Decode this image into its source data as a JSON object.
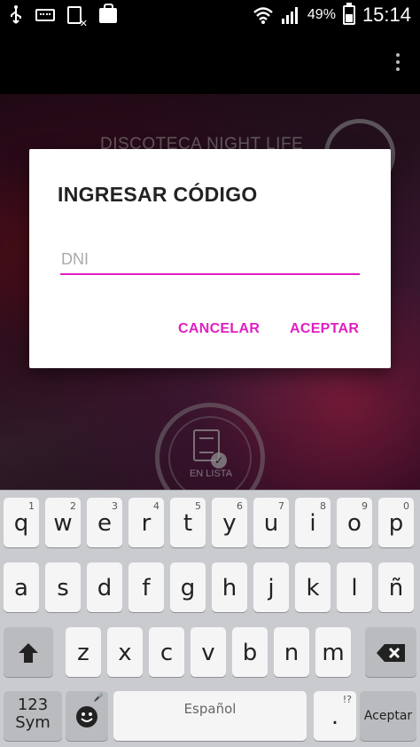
{
  "status_bar": {
    "battery_percent": "49%",
    "time": "15:14",
    "icons": [
      "usb-icon",
      "keyboard-icon",
      "sim-error-icon",
      "shopping-bag-icon",
      "wifi-icon",
      "signal-icon",
      "battery-charging-icon"
    ]
  },
  "app_bar": {
    "menu_icon": "overflow-menu-icon"
  },
  "background": {
    "venue_title": "DISCOTECA NIGHT LIFE",
    "badge_label": "EN LISTA"
  },
  "dialog": {
    "title": "INGRESAR CÓDIGO",
    "input_value": "",
    "input_placeholder": "DNI",
    "cancel_label": "CANCELAR",
    "accept_label": "ACEPTAR",
    "accent_color": "#e01fc2"
  },
  "keyboard": {
    "row1": [
      {
        "k": "q",
        "n": "1"
      },
      {
        "k": "w",
        "n": "2"
      },
      {
        "k": "e",
        "n": "3"
      },
      {
        "k": "r",
        "n": "4"
      },
      {
        "k": "t",
        "n": "5"
      },
      {
        "k": "y",
        "n": "6"
      },
      {
        "k": "u",
        "n": "7"
      },
      {
        "k": "i",
        "n": "8"
      },
      {
        "k": "o",
        "n": "9"
      },
      {
        "k": "p",
        "n": "0"
      }
    ],
    "row2": [
      "a",
      "s",
      "d",
      "f",
      "g",
      "h",
      "j",
      "k",
      "l",
      "ñ"
    ],
    "row3": [
      "z",
      "x",
      "c",
      "v",
      "b",
      "n",
      "m"
    ],
    "symbols_label": "123\nSym",
    "space_label": "Español",
    "period_label": ".",
    "period_sub": "!?",
    "enter_label": "Aceptar",
    "mic_sub": "🎤"
  }
}
